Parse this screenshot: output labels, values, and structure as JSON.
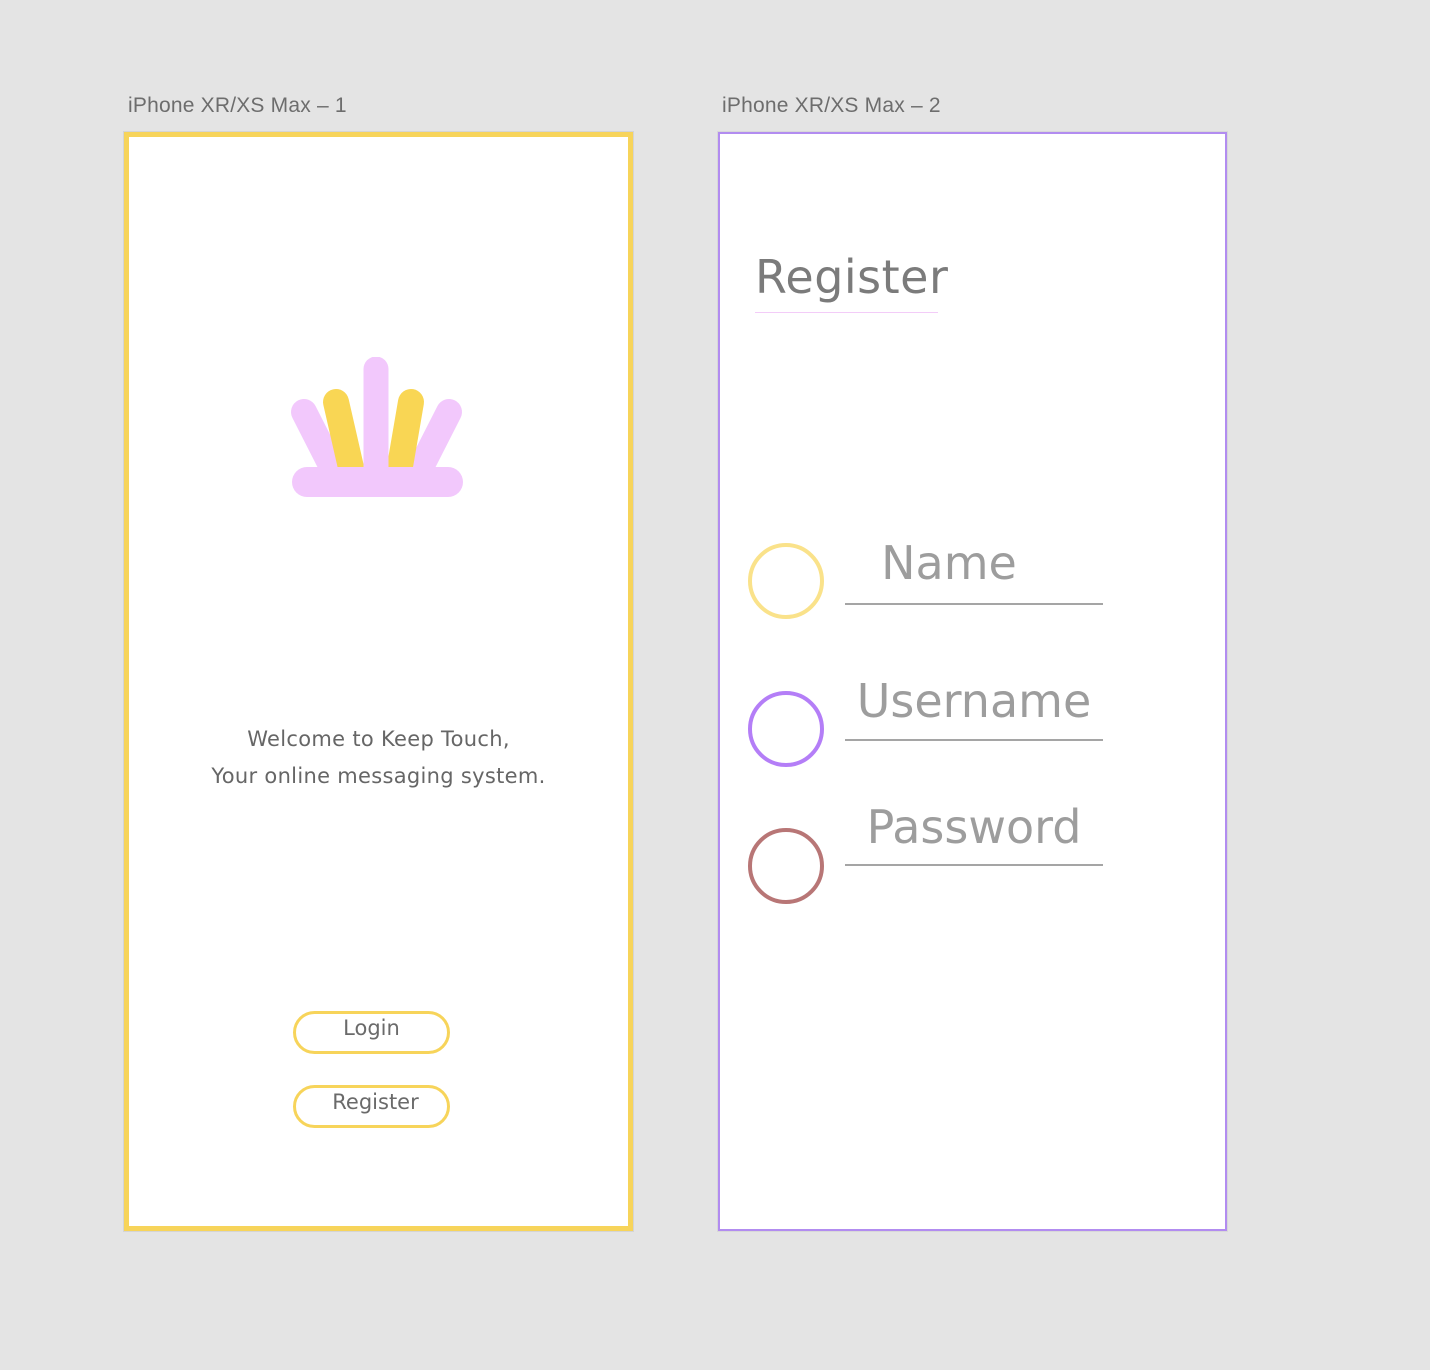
{
  "artboards": [
    {
      "title": "iPhone XR/XS Max – 1",
      "welcome": {
        "line1": "Welcome to Keep Touch,",
        "line2": "Your online messaging system."
      },
      "buttons": {
        "login": "Login",
        "register": "Register"
      }
    },
    {
      "title": "iPhone XR/XS Max – 2",
      "heading": "Register",
      "fields": [
        {
          "label": "Name",
          "circle_color": "#fae28a"
        },
        {
          "label": "Username",
          "circle_color": "#b47ef7"
        },
        {
          "label": "Password",
          "circle_color": "#b87676"
        }
      ]
    }
  ],
  "colors": {
    "canvas": "#e4e4e4",
    "accent_yellow": "#f7d45a",
    "accent_pink": "#f2c8fc",
    "accent_purple": "#b28cf0",
    "text_gray": "#666666"
  },
  "icons": {
    "logo": "crown-hand-logo-icon"
  }
}
